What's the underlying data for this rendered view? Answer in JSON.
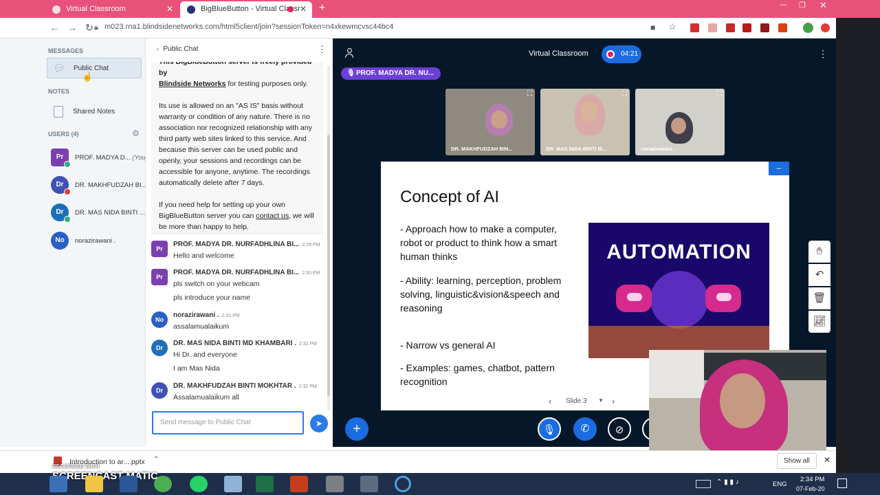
{
  "browser": {
    "tabs": [
      {
        "title": "Virtual Classroom",
        "active": false
      },
      {
        "title": "BigBlueButton - Virtual Classr",
        "active": true
      }
    ],
    "url": "m023.rna1.blindsidenetworks.com/html5client/join?sessionToken=n4xkewmcvsc44bc4"
  },
  "sidebar": {
    "messages_title": "MESSAGES",
    "public_chat_label": "Public Chat",
    "notes_title": "NOTES",
    "shared_notes_label": "Shared Notes",
    "users_title": "USERS (4)",
    "users": [
      {
        "initials": "Pr",
        "name": "PROF. MADYA D...",
        "you": "(You)",
        "color": "#7b3fb0"
      },
      {
        "initials": "Dr",
        "name": "DR. MAKHFUDZAH BI...",
        "color": "#3f51b5"
      },
      {
        "initials": "Dr",
        "name": "DR. MAS NIDA BINTI ...",
        "color": "#1e6fb8"
      },
      {
        "initials": "No",
        "name": "norazirawani .",
        "color": "#2a5fc4"
      }
    ]
  },
  "chat": {
    "header": "Public Chat",
    "welcome": {
      "line1a": "This BigBlueButton server is freely provided by",
      "link1": "Blindside Networks",
      "line1b": " for testing purposes only.",
      "para2": "Its use is allowed on an \"AS IS\" basis without warranty or condition of any nature. There is no association nor recognized relationship with any third party web sites linked to this service. And because this server can be used public and openly, your sessions and recordings can be accessible for anyone, anytime. The recordings automatically delete after 7 days.",
      "para3a": "If you need help for setting up your own BigBlueButton server you can ",
      "link2": "contact us",
      "para3b": ", we will be more than happy to help."
    },
    "messages": [
      {
        "initials": "Pr",
        "name": "PROF. MADYA DR. NURFADHLINA BI...",
        "time": "2:29 PM",
        "lines": [
          "Hello and welcome"
        ],
        "color": "#7b3fb0"
      },
      {
        "initials": "Pr",
        "name": "PROF. MADYA DR. NURFADHLINA BI...",
        "time": "2:30 PM",
        "lines": [
          "pls switch on your webcam",
          "pls introduce your name"
        ],
        "color": "#7b3fb0"
      },
      {
        "initials": "No",
        "name": "norazirawani .",
        "time": "2:31 PM",
        "lines": [
          "assalamualaikum"
        ],
        "color": "#2a5fc4"
      },
      {
        "initials": "Dr",
        "name": "DR. MAS NIDA BINTI MD KHAMBARI .",
        "time": "2:32 PM",
        "lines": [
          "Hi Dr. and everyone",
          "I am Mas Nida"
        ],
        "color": "#1e6fb8"
      },
      {
        "initials": "Dr",
        "name": "DR. MAKHFUDZAH BINTI MOKHTAR .",
        "time": "2:32 PM",
        "lines": [
          "Assalamualaikum all"
        ],
        "color": "#3f51b5"
      }
    ],
    "input_placeholder": "Send message to Public Chat"
  },
  "presentation": {
    "title": "Virtual Classroom",
    "timer": "04:21",
    "talker": "PROF. MADYA DR. NU...",
    "cams": [
      {
        "name": "DR. MAKHFUDZAH BIN..."
      },
      {
        "name": "DR. MAS NIDA BINTI M..."
      },
      {
        "name": "norazirawani ."
      }
    ],
    "slide": {
      "title": "Concept of AI",
      "bullets": [
        "- Approach how to make a computer, robot or product to think how a smart human thinks",
        "- Ability: learning, perception, problem solving, linguistic&vision&speech and reasoning",
        "- Narrow vs general AI",
        "- Examples: games, chatbot, pattern recognition"
      ],
      "image_text": "AUTOMATION"
    },
    "slide_label": "Slide 3"
  },
  "downloads": {
    "file": "Introduction to ar....pptx",
    "show_all": "Show all"
  },
  "watermark": "SCREENCAST  MATIC",
  "watermark_small": "RECORDED WITH",
  "taskbar": {
    "lang": "ENG",
    "time": "2:34 PM",
    "date": "07-Feb-20"
  }
}
